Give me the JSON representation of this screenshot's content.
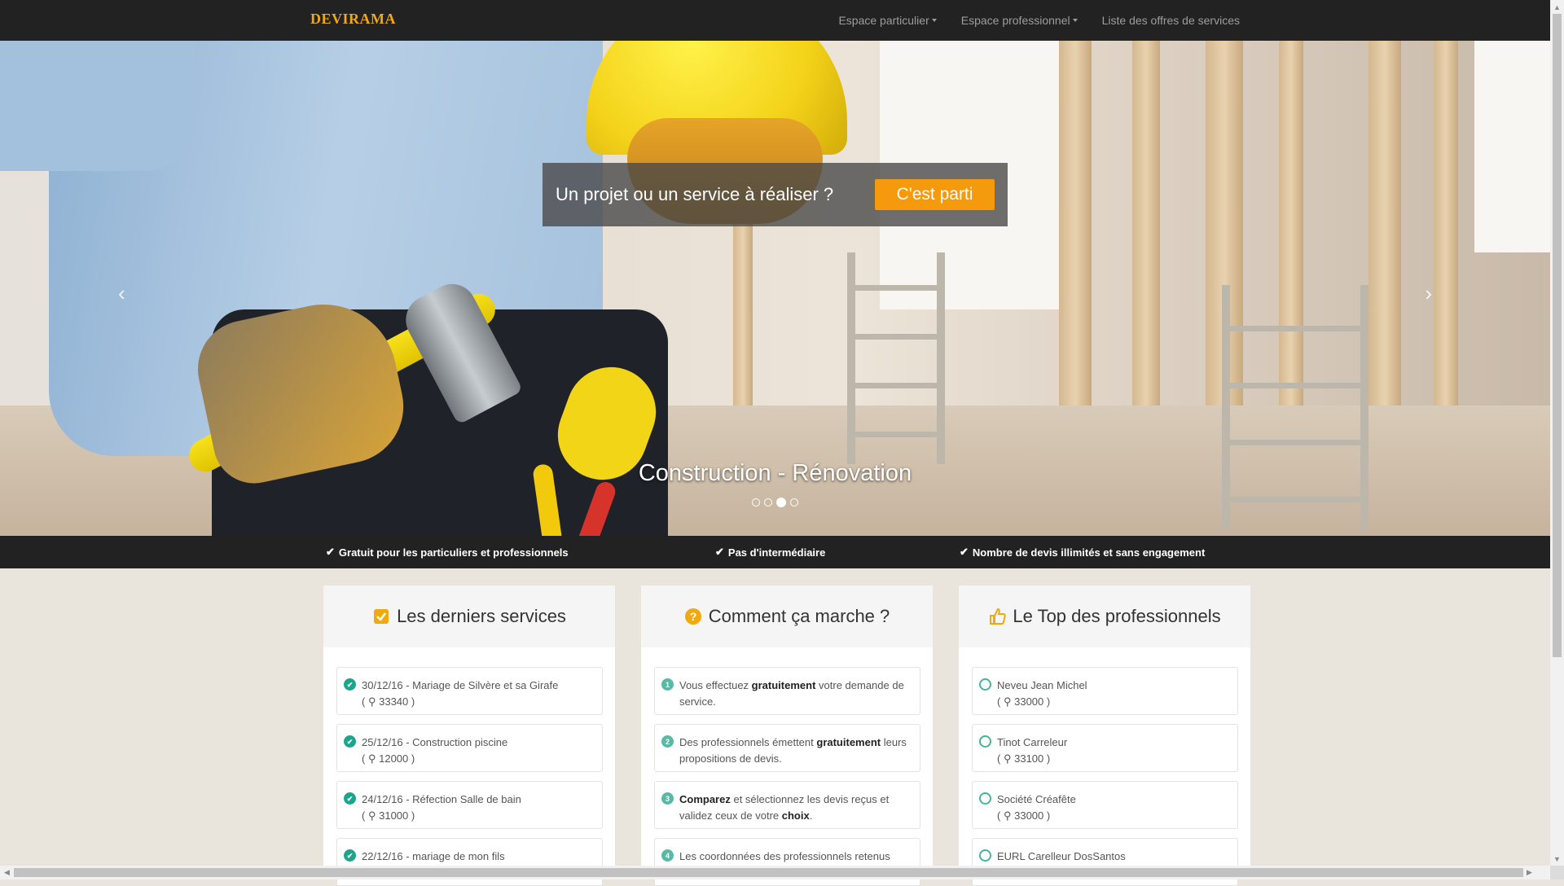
{
  "navbar": {
    "brand": "DEVIRAMA",
    "links": [
      {
        "label": "Espace particulier",
        "dropdown": true
      },
      {
        "label": "Espace professionnel",
        "dropdown": true
      },
      {
        "label": "Liste des offres de services",
        "dropdown": false
      }
    ]
  },
  "hero": {
    "cta_text": "Un projet ou un service à réaliser ?",
    "cta_button": "C'est parti",
    "caption": "Construction - Rénovation",
    "indicator_count": 4,
    "active_indicator": 3
  },
  "features": [
    "Gratuit pour les particuliers et professionnels",
    "Pas d'intermédiaire",
    "Nombre de devis illimités et sans engagement"
  ],
  "columns": {
    "services": {
      "title": "Les derniers services",
      "icon": "checkbox-icon",
      "items": [
        {
          "line": "30/12/16 - Mariage de Silvère et sa Girafe",
          "zip": "33340"
        },
        {
          "line": "25/12/16 - Construction piscine",
          "zip": "12000"
        },
        {
          "line": "24/12/16 - Réfection Salle de bain",
          "zip": "31000"
        },
        {
          "line": "22/12/16 - mariage de mon fils",
          "zip": ""
        }
      ]
    },
    "how": {
      "title": "Comment ça marche ?",
      "icon": "question-circle-icon",
      "steps": [
        {
          "num": "1",
          "pre": "Vous effectuez ",
          "bold": "gratuitement",
          "post": " votre demande de service."
        },
        {
          "num": "2",
          "pre": "Des professionnels émettent ",
          "bold": "gratuitement",
          "post": " leurs propositions de devis."
        },
        {
          "num": "3",
          "pre": "",
          "bold": "Comparez",
          "post": " et sélectionnez les devis reçus et validez ceux de votre ",
          "bold2": "choix",
          "post2": "."
        },
        {
          "num": "4",
          "pre": "Les coordonnées des professionnels retenus",
          "bold": "",
          "post": ""
        }
      ]
    },
    "top": {
      "title": "Le Top des professionnels",
      "icon": "thumbs-up-icon",
      "items": [
        {
          "name": "Neveu Jean Michel",
          "zip": "33000"
        },
        {
          "name": "Tinot Carreleur",
          "zip": "33100"
        },
        {
          "name": "Société Créafête",
          "zip": "33000"
        },
        {
          "name": "EURL Carelleur DosSantos",
          "zip": ""
        }
      ]
    }
  },
  "colors": {
    "brand": "#f0a90e",
    "cta": "#f59a0c",
    "navbar": "#222222",
    "check": "#1da58c"
  }
}
